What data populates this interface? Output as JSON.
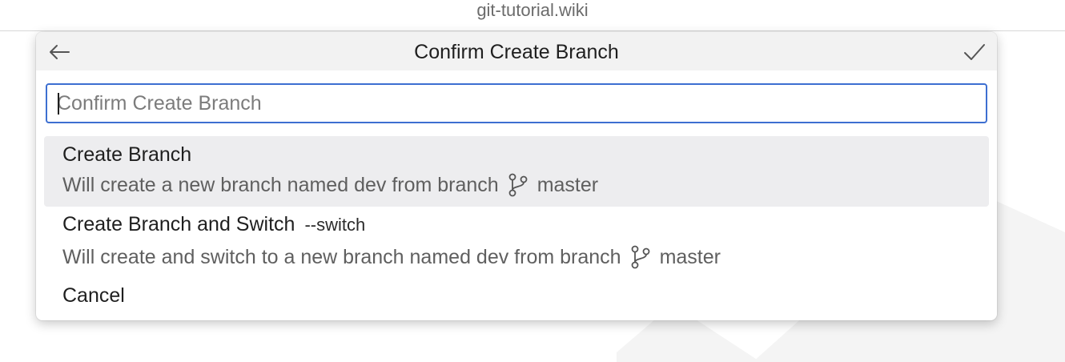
{
  "window": {
    "title": "git-tutorial.wiki"
  },
  "quick_pick": {
    "title": "Confirm Create Branch",
    "back_icon": "arrow-left-icon",
    "ok_icon": "check-icon",
    "input": {
      "value": "",
      "placeholder": "Confirm Create Branch"
    },
    "items": [
      {
        "label": "Create Branch",
        "flag": "",
        "description_prefix": "Will create a new branch named dev from branch",
        "branch_icon": "git-branch-icon",
        "branch": "master",
        "selected": true
      },
      {
        "label": "Create Branch and Switch",
        "flag": "--switch",
        "description_prefix": "Will create and switch to a new branch named dev from branch",
        "branch_icon": "git-branch-icon",
        "branch": "master",
        "selected": false
      },
      {
        "label": "Cancel",
        "selected": false
      }
    ]
  },
  "colors": {
    "accent_focus_border": "#3d6fd1",
    "selected_row_bg": "#ededef",
    "header_bg": "#f2f2f2"
  }
}
